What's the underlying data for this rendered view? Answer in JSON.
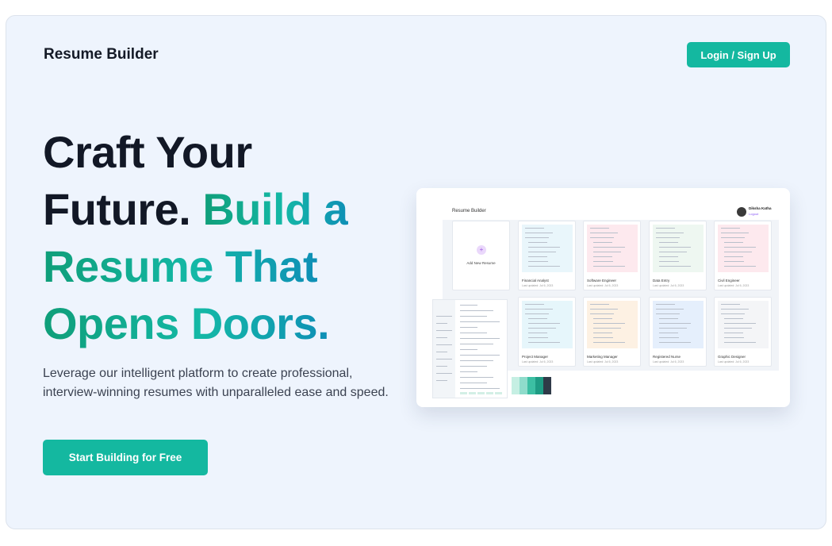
{
  "header": {
    "brand": "Resume Builder",
    "login_label": "Login / Sign Up"
  },
  "hero": {
    "line1": "Craft Your",
    "line2_dark": "Future.",
    "line2_accent": "Build a",
    "line3": "Resume That",
    "line4": "Opens Doors.",
    "subtitle": "Leverage our intelligent platform to create professional, interview-winning resumes with unparalleled ease and speed.",
    "cta_label": "Start Building for Free"
  },
  "preview": {
    "title": "Resume Builder",
    "user_name": "Diksha Katha",
    "logout_label": "Logout",
    "add_label": "Add New Resume",
    "resumes": [
      {
        "name": "Financial Analyst",
        "date": "Last updated: Jul 6, 2023",
        "tint": "#e9f6fb"
      },
      {
        "name": "Software Engineer",
        "date": "Last updated: Jul 6, 2023",
        "tint": "#fde9ee"
      },
      {
        "name": "Data Entry",
        "date": "Last updated: Jul 6, 2023",
        "tint": "#eef7f1"
      },
      {
        "name": "Civil Engineer",
        "date": "Last updated: Jul 6, 2023",
        "tint": "#fde9ee"
      },
      {
        "name": "Project Manager",
        "date": "Last updated: Jul 6, 2023",
        "tint": "#e6f6fb"
      },
      {
        "name": "Marketing Manager",
        "date": "Last updated: Jul 6, 2023",
        "tint": "#fdf1e3"
      },
      {
        "name": "Registered Nurse",
        "date": "Last updated: Jul 6, 2023",
        "tint": "#e5effc"
      },
      {
        "name": "Graphic Designer",
        "date": "Last updated: Jul 6, 2023",
        "tint": "#f4f5f7"
      }
    ],
    "swatches": [
      "#c5efe3",
      "#8fdccb",
      "#3cbfa3",
      "#1e9c84",
      "#2f3a48"
    ]
  }
}
